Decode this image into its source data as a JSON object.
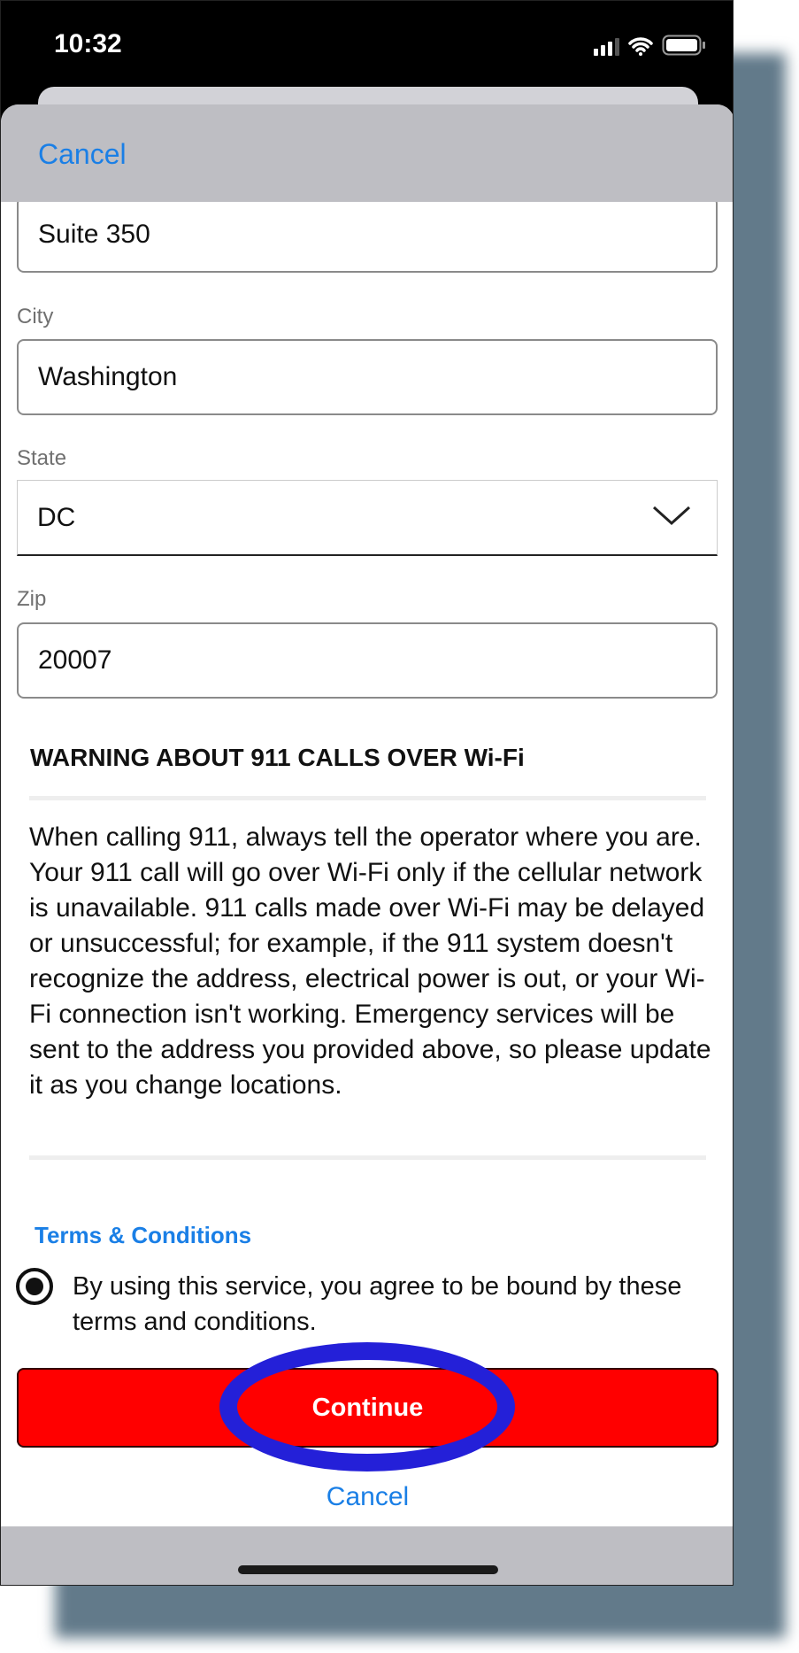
{
  "status_bar": {
    "time": "10:32",
    "icons": [
      "cellular-signal-icon",
      "wifi-icon",
      "battery-icon"
    ]
  },
  "header": {
    "cancel_label": "Cancel"
  },
  "form": {
    "address2_value": "Suite 350",
    "city": {
      "label": "City",
      "value": "Washington"
    },
    "state": {
      "label": "State",
      "value": "DC"
    },
    "zip": {
      "label": "Zip",
      "value": "20007"
    }
  },
  "warning": {
    "title": "WARNING ABOUT 911 CALLS OVER Wi-Fi",
    "body": "When calling 911, always tell the operator where you are. Your 911 call will go over Wi-Fi only if the cellular network is unavailable. 911 calls made over Wi-Fi may be delayed or unsuccessful; for example, if the 911 system doesn't recognize the address, electrical power is out, or your Wi-Fi connection isn't working. Emergency services will be sent to the address you provided above, so please update it as you change locations."
  },
  "terms": {
    "link_label": "Terms & Conditions",
    "agree_text": "By using this service, you agree to be bound by these terms and conditions.",
    "agreed": true
  },
  "actions": {
    "continue_label": "Continue",
    "cancel_label": "Cancel"
  },
  "colors": {
    "accent": "#1a7fe6",
    "primary_button": "#ff0000",
    "highlight_annotation": "#2420d8"
  }
}
